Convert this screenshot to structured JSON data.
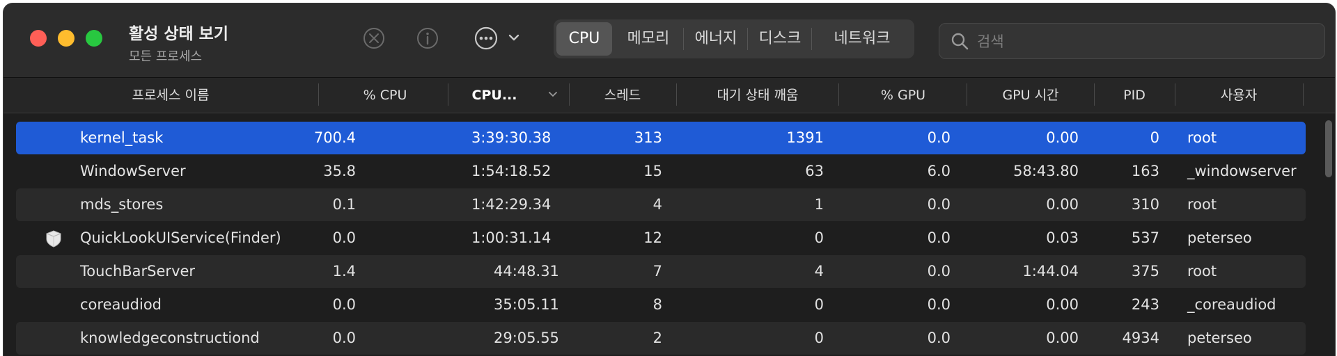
{
  "window": {
    "title": "활성 상태 보기",
    "subtitle": "모든 프로세스"
  },
  "toolbar": {
    "stop_icon": "stop-process-icon",
    "info_icon": "info-icon",
    "more_icon": "more-ellipsis-icon",
    "tabs": [
      {
        "label": "CPU",
        "active": true
      },
      {
        "label": "메모리",
        "active": false
      },
      {
        "label": "에너지",
        "active": false
      },
      {
        "label": "디스크",
        "active": false
      },
      {
        "label": "네트워크",
        "active": false
      }
    ]
  },
  "search": {
    "placeholder": "검색",
    "value": ""
  },
  "columns": {
    "name": "프로세스 이름",
    "cpu": "% CPU",
    "cpu_time": "CPU...",
    "threads": "스레드",
    "idle_wakeups": "대기 상태 깨움",
    "gpu": "% GPU",
    "gpu_time": "GPU 시간",
    "pid": "PID",
    "user": "사용자"
  },
  "rows": [
    {
      "name": "kernel_task",
      "cpu": "700.4",
      "cpu_time": "3:39:30.38",
      "threads": "313",
      "idle_wakeups": "1391",
      "gpu": "0.0",
      "gpu_time": "0.00",
      "pid": "0",
      "user": "root",
      "selected": true
    },
    {
      "name": "WindowServer",
      "cpu": "35.8",
      "cpu_time": "1:54:18.52",
      "threads": "15",
      "idle_wakeups": "63",
      "gpu": "6.0",
      "gpu_time": "58:43.80",
      "pid": "163",
      "user": "_windowserver"
    },
    {
      "name": "mds_stores",
      "cpu": "0.1",
      "cpu_time": "1:42:29.34",
      "threads": "4",
      "idle_wakeups": "1",
      "gpu": "0.0",
      "gpu_time": "0.00",
      "pid": "310",
      "user": "root"
    },
    {
      "name": "QuickLookUIService(Finder)",
      "cpu": "0.0",
      "cpu_time": "1:00:31.14",
      "threads": "12",
      "idle_wakeups": "0",
      "gpu": "0.0",
      "gpu_time": "0.03",
      "pid": "537",
      "user": "peterseo",
      "icon": "shield-icon"
    },
    {
      "name": "TouchBarServer",
      "cpu": "1.4",
      "cpu_time": "44:48.31",
      "threads": "7",
      "idle_wakeups": "4",
      "gpu": "0.0",
      "gpu_time": "1:44.04",
      "pid": "375",
      "user": "root"
    },
    {
      "name": "coreaudiod",
      "cpu": "0.0",
      "cpu_time": "35:05.11",
      "threads": "8",
      "idle_wakeups": "0",
      "gpu": "0.0",
      "gpu_time": "0.00",
      "pid": "243",
      "user": "_coreaudiod"
    },
    {
      "name": "knowledgeconstructiond",
      "cpu": "0.0",
      "cpu_time": "29:05.55",
      "threads": "2",
      "idle_wakeups": "0",
      "gpu": "0.0",
      "gpu_time": "0.00",
      "pid": "4934",
      "user": "peterseo"
    }
  ],
  "colors": {
    "selected_row": "#1f5bd6",
    "close": "#ff5f57",
    "minimize": "#febc2e",
    "maximize": "#28c840"
  }
}
